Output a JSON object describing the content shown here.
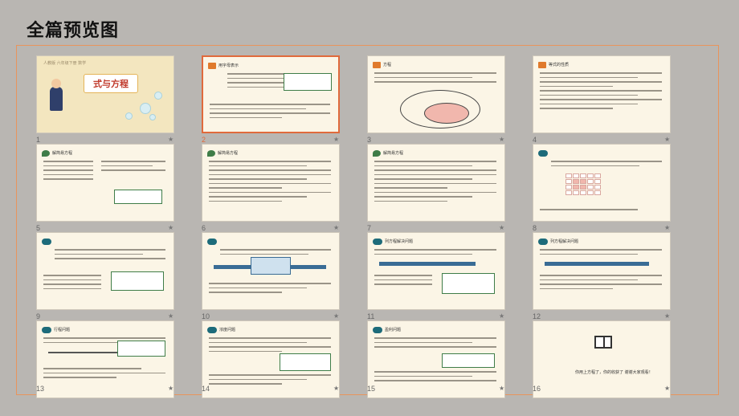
{
  "title": "全篇预览图",
  "colors": {
    "background": "#b9b6b2",
    "panel_border": "#e8945c",
    "selected_border": "#e06a3c",
    "slide_bg": "#fbf5e6"
  },
  "slides": [
    {
      "number": "1",
      "heading": "式与方程",
      "top_text": "人教版  六年级下册  数学"
    },
    {
      "number": "2",
      "heading": "用字母表示",
      "selected": true
    },
    {
      "number": "3",
      "heading": "方程"
    },
    {
      "number": "4",
      "heading": "等式的性质"
    },
    {
      "number": "5",
      "heading": "解简易方程"
    },
    {
      "number": "6",
      "heading": "解简易方程"
    },
    {
      "number": "7",
      "heading": "解简易方程"
    },
    {
      "number": "8",
      "heading": ""
    },
    {
      "number": "9",
      "heading": ""
    },
    {
      "number": "10",
      "heading": ""
    },
    {
      "number": "11",
      "heading": "列方程解决问题"
    },
    {
      "number": "12",
      "heading": "列方程解决问题"
    },
    {
      "number": "13",
      "heading": "行程问题"
    },
    {
      "number": "14",
      "heading": "浓度问题"
    },
    {
      "number": "15",
      "heading": "盈利问题"
    },
    {
      "number": "16",
      "heading": "",
      "end_text": "你用上方程了，你的收获了  谢谢大家观看！"
    }
  ],
  "star_icon": "star-icon"
}
